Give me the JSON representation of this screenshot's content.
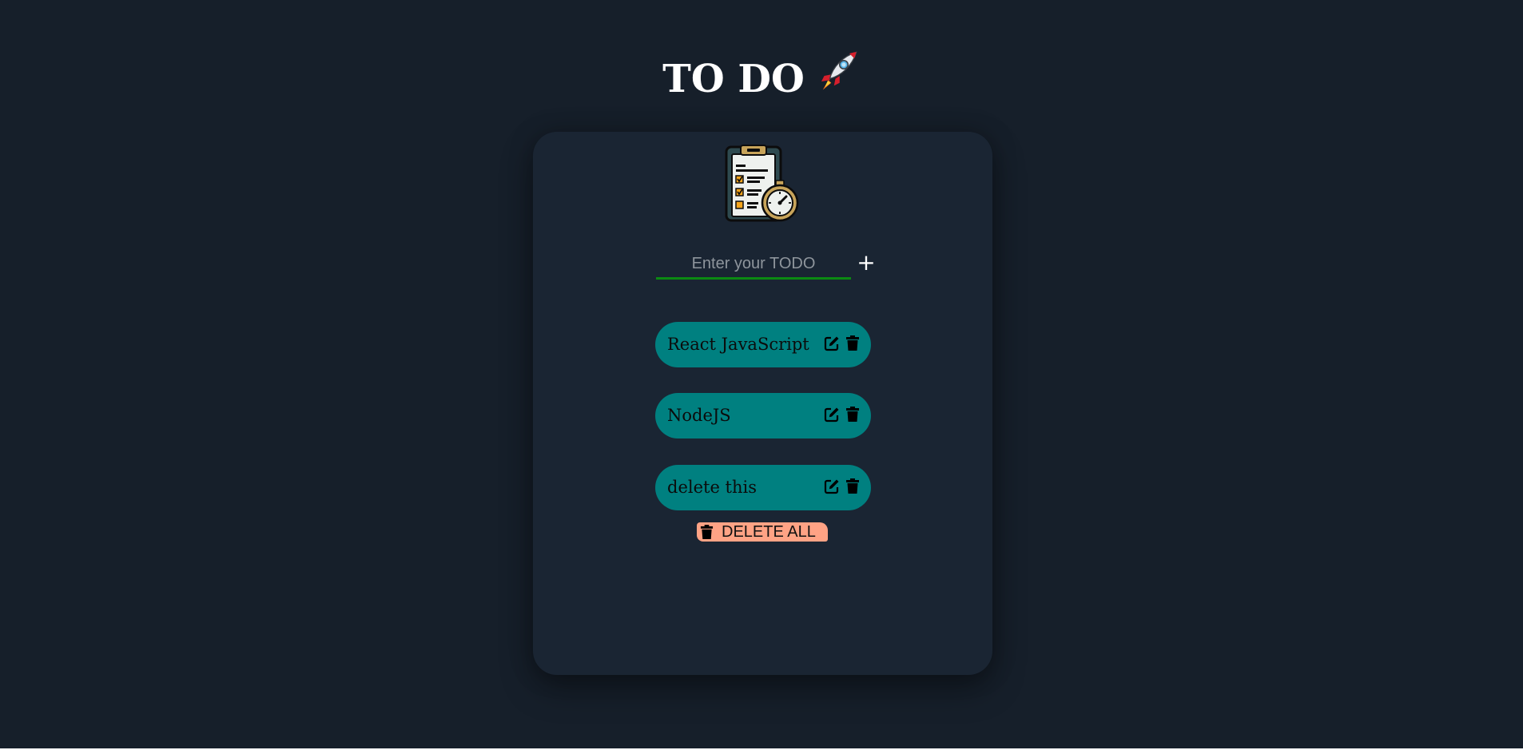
{
  "header": {
    "title": "TO DO",
    "title_icon": "rocket-icon"
  },
  "card": {
    "logo_icon": "clipboard-stopwatch-icon",
    "input": {
      "placeholder": "Enter your TODO",
      "value": ""
    },
    "add_button_label": "+",
    "items": [
      {
        "text": "React JavaScript"
      },
      {
        "text": "NodeJS"
      },
      {
        "text": "delete this"
      }
    ],
    "delete_all_label": "DELETE ALL"
  },
  "colors": {
    "page_background": "#161f2a",
    "card_background": "#1a2533",
    "item_background": "#008080",
    "input_underline": "#0b8a12",
    "delete_all_background": "#ffa385"
  }
}
